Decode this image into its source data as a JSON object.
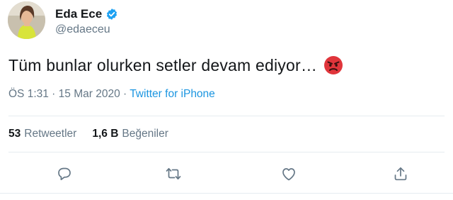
{
  "user": {
    "display_name": "Eda Ece",
    "handle": "@edaeceu",
    "verified": true,
    "avatar_icon": "profile-photo"
  },
  "tweet": {
    "text": "Tüm bunlar olurken setler devam ediyor…",
    "emoji": "angry-face-emoji"
  },
  "meta": {
    "time": "ÖS 1:31",
    "separator": " · ",
    "date": "15 Mar 2020",
    "source": "Twitter for iPhone"
  },
  "stats": {
    "retweets_count": "53",
    "retweets_label": "Retweetler",
    "likes_count": "1,6 B",
    "likes_label": "Beğeniler"
  },
  "actions": [
    "reply-icon",
    "retweet-icon",
    "like-icon",
    "share-icon"
  ],
  "colors": {
    "text": "#14171a",
    "secondary": "#657786",
    "link": "#1b95e0",
    "verified": "#1da1f2",
    "divider": "#e6ecf0",
    "emoji": "#e0353b"
  }
}
